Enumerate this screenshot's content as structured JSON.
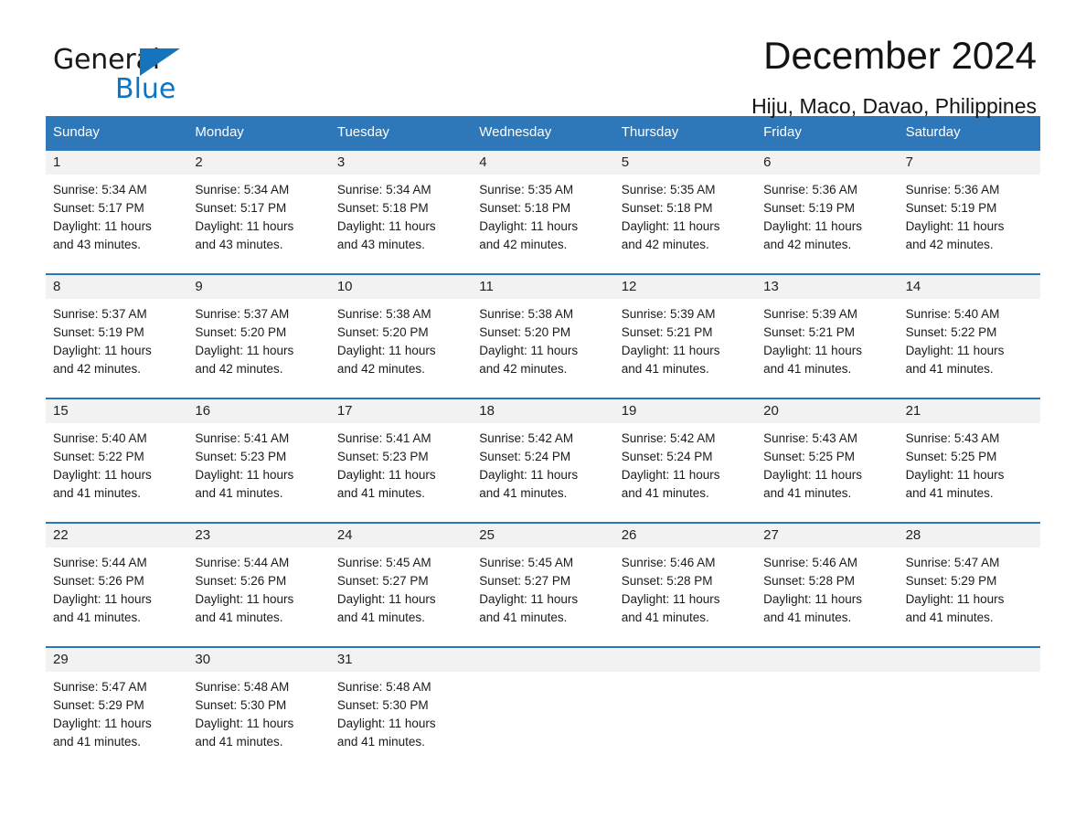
{
  "brand": {
    "name_part1": "General",
    "name_part2": "Blue",
    "triangle_color": "#1574bb",
    "blue_color": "#0c74c4"
  },
  "header": {
    "title": "December 2024",
    "subtitle": "Hiju, Maco, Davao, Philippines",
    "header_bg_color": "#2e77b8",
    "header_text_color": "#ffffff",
    "daynum_band_color": "#f2f2f2"
  },
  "weekdays": [
    "Sunday",
    "Monday",
    "Tuesday",
    "Wednesday",
    "Thursday",
    "Friday",
    "Saturday"
  ],
  "weeks": [
    [
      {
        "day": "1",
        "sunrise": "Sunrise: 5:34 AM",
        "sunset": "Sunset: 5:17 PM",
        "daylight1": "Daylight: 11 hours",
        "daylight2": "and 43 minutes."
      },
      {
        "day": "2",
        "sunrise": "Sunrise: 5:34 AM",
        "sunset": "Sunset: 5:17 PM",
        "daylight1": "Daylight: 11 hours",
        "daylight2": "and 43 minutes."
      },
      {
        "day": "3",
        "sunrise": "Sunrise: 5:34 AM",
        "sunset": "Sunset: 5:18 PM",
        "daylight1": "Daylight: 11 hours",
        "daylight2": "and 43 minutes."
      },
      {
        "day": "4",
        "sunrise": "Sunrise: 5:35 AM",
        "sunset": "Sunset: 5:18 PM",
        "daylight1": "Daylight: 11 hours",
        "daylight2": "and 42 minutes."
      },
      {
        "day": "5",
        "sunrise": "Sunrise: 5:35 AM",
        "sunset": "Sunset: 5:18 PM",
        "daylight1": "Daylight: 11 hours",
        "daylight2": "and 42 minutes."
      },
      {
        "day": "6",
        "sunrise": "Sunrise: 5:36 AM",
        "sunset": "Sunset: 5:19 PM",
        "daylight1": "Daylight: 11 hours",
        "daylight2": "and 42 minutes."
      },
      {
        "day": "7",
        "sunrise": "Sunrise: 5:36 AM",
        "sunset": "Sunset: 5:19 PM",
        "daylight1": "Daylight: 11 hours",
        "daylight2": "and 42 minutes."
      }
    ],
    [
      {
        "day": "8",
        "sunrise": "Sunrise: 5:37 AM",
        "sunset": "Sunset: 5:19 PM",
        "daylight1": "Daylight: 11 hours",
        "daylight2": "and 42 minutes."
      },
      {
        "day": "9",
        "sunrise": "Sunrise: 5:37 AM",
        "sunset": "Sunset: 5:20 PM",
        "daylight1": "Daylight: 11 hours",
        "daylight2": "and 42 minutes."
      },
      {
        "day": "10",
        "sunrise": "Sunrise: 5:38 AM",
        "sunset": "Sunset: 5:20 PM",
        "daylight1": "Daylight: 11 hours",
        "daylight2": "and 42 minutes."
      },
      {
        "day": "11",
        "sunrise": "Sunrise: 5:38 AM",
        "sunset": "Sunset: 5:20 PM",
        "daylight1": "Daylight: 11 hours",
        "daylight2": "and 42 minutes."
      },
      {
        "day": "12",
        "sunrise": "Sunrise: 5:39 AM",
        "sunset": "Sunset: 5:21 PM",
        "daylight1": "Daylight: 11 hours",
        "daylight2": "and 41 minutes."
      },
      {
        "day": "13",
        "sunrise": "Sunrise: 5:39 AM",
        "sunset": "Sunset: 5:21 PM",
        "daylight1": "Daylight: 11 hours",
        "daylight2": "and 41 minutes."
      },
      {
        "day": "14",
        "sunrise": "Sunrise: 5:40 AM",
        "sunset": "Sunset: 5:22 PM",
        "daylight1": "Daylight: 11 hours",
        "daylight2": "and 41 minutes."
      }
    ],
    [
      {
        "day": "15",
        "sunrise": "Sunrise: 5:40 AM",
        "sunset": "Sunset: 5:22 PM",
        "daylight1": "Daylight: 11 hours",
        "daylight2": "and 41 minutes."
      },
      {
        "day": "16",
        "sunrise": "Sunrise: 5:41 AM",
        "sunset": "Sunset: 5:23 PM",
        "daylight1": "Daylight: 11 hours",
        "daylight2": "and 41 minutes."
      },
      {
        "day": "17",
        "sunrise": "Sunrise: 5:41 AM",
        "sunset": "Sunset: 5:23 PM",
        "daylight1": "Daylight: 11 hours",
        "daylight2": "and 41 minutes."
      },
      {
        "day": "18",
        "sunrise": "Sunrise: 5:42 AM",
        "sunset": "Sunset: 5:24 PM",
        "daylight1": "Daylight: 11 hours",
        "daylight2": "and 41 minutes."
      },
      {
        "day": "19",
        "sunrise": "Sunrise: 5:42 AM",
        "sunset": "Sunset: 5:24 PM",
        "daylight1": "Daylight: 11 hours",
        "daylight2": "and 41 minutes."
      },
      {
        "day": "20",
        "sunrise": "Sunrise: 5:43 AM",
        "sunset": "Sunset: 5:25 PM",
        "daylight1": "Daylight: 11 hours",
        "daylight2": "and 41 minutes."
      },
      {
        "day": "21",
        "sunrise": "Sunrise: 5:43 AM",
        "sunset": "Sunset: 5:25 PM",
        "daylight1": "Daylight: 11 hours",
        "daylight2": "and 41 minutes."
      }
    ],
    [
      {
        "day": "22",
        "sunrise": "Sunrise: 5:44 AM",
        "sunset": "Sunset: 5:26 PM",
        "daylight1": "Daylight: 11 hours",
        "daylight2": "and 41 minutes."
      },
      {
        "day": "23",
        "sunrise": "Sunrise: 5:44 AM",
        "sunset": "Sunset: 5:26 PM",
        "daylight1": "Daylight: 11 hours",
        "daylight2": "and 41 minutes."
      },
      {
        "day": "24",
        "sunrise": "Sunrise: 5:45 AM",
        "sunset": "Sunset: 5:27 PM",
        "daylight1": "Daylight: 11 hours",
        "daylight2": "and 41 minutes."
      },
      {
        "day": "25",
        "sunrise": "Sunrise: 5:45 AM",
        "sunset": "Sunset: 5:27 PM",
        "daylight1": "Daylight: 11 hours",
        "daylight2": "and 41 minutes."
      },
      {
        "day": "26",
        "sunrise": "Sunrise: 5:46 AM",
        "sunset": "Sunset: 5:28 PM",
        "daylight1": "Daylight: 11 hours",
        "daylight2": "and 41 minutes."
      },
      {
        "day": "27",
        "sunrise": "Sunrise: 5:46 AM",
        "sunset": "Sunset: 5:28 PM",
        "daylight1": "Daylight: 11 hours",
        "daylight2": "and 41 minutes."
      },
      {
        "day": "28",
        "sunrise": "Sunrise: 5:47 AM",
        "sunset": "Sunset: 5:29 PM",
        "daylight1": "Daylight: 11 hours",
        "daylight2": "and 41 minutes."
      }
    ],
    [
      {
        "day": "29",
        "sunrise": "Sunrise: 5:47 AM",
        "sunset": "Sunset: 5:29 PM",
        "daylight1": "Daylight: 11 hours",
        "daylight2": "and 41 minutes."
      },
      {
        "day": "30",
        "sunrise": "Sunrise: 5:48 AM",
        "sunset": "Sunset: 5:30 PM",
        "daylight1": "Daylight: 11 hours",
        "daylight2": "and 41 minutes."
      },
      {
        "day": "31",
        "sunrise": "Sunrise: 5:48 AM",
        "sunset": "Sunset: 5:30 PM",
        "daylight1": "Daylight: 11 hours",
        "daylight2": "and 41 minutes."
      },
      {
        "day": "",
        "sunrise": "",
        "sunset": "",
        "daylight1": "",
        "daylight2": ""
      },
      {
        "day": "",
        "sunrise": "",
        "sunset": "",
        "daylight1": "",
        "daylight2": ""
      },
      {
        "day": "",
        "sunrise": "",
        "sunset": "",
        "daylight1": "",
        "daylight2": ""
      },
      {
        "day": "",
        "sunrise": "",
        "sunset": "",
        "daylight1": "",
        "daylight2": ""
      }
    ]
  ]
}
